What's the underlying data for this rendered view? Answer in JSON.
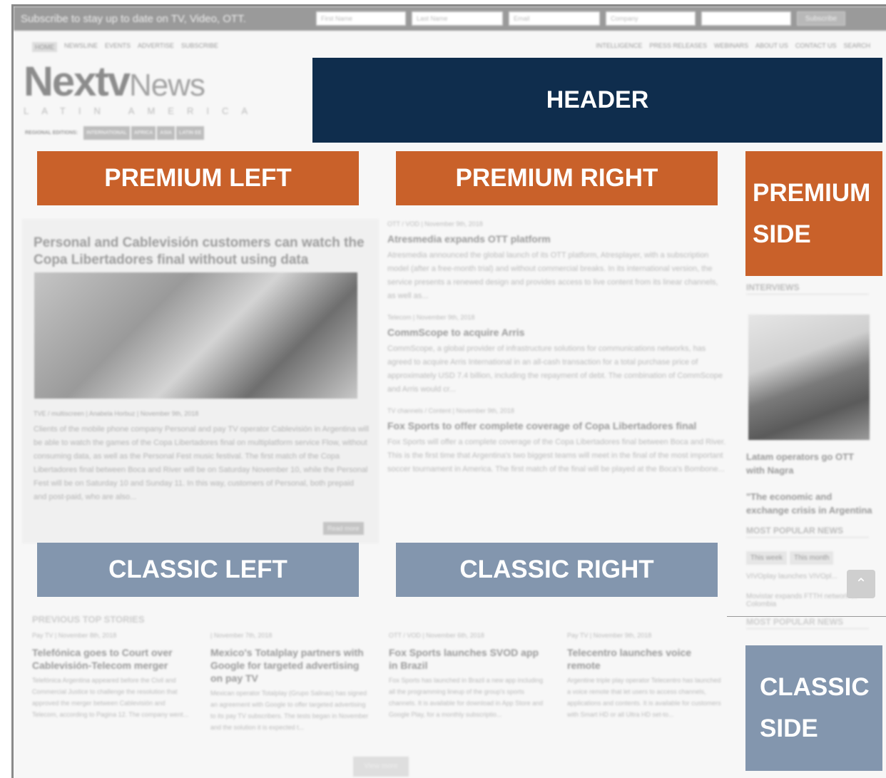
{
  "subscribe": {
    "text": "Subscribe to stay up to date on TV, Video, OTT.",
    "first_name_ph": "First Name",
    "last_name_ph": "Last Name",
    "email_ph": "Email",
    "company_ph": "Company",
    "button": "Subscribe"
  },
  "nav": {
    "left": [
      "Home",
      "Newsline",
      "Events",
      "Advertise",
      "Subscribe"
    ],
    "right": [
      "Intelligence",
      "Press Releases",
      "Webinars",
      "About Us",
      "Contact Us",
      "Search"
    ]
  },
  "logo": {
    "bold": "Nextv",
    "thin": "News",
    "sub": "LATIN AMERICA"
  },
  "editions": {
    "label": "REGIONAL EDITIONS:",
    "items": [
      "INTERNATIONAL",
      "AFRICA",
      "ASIA",
      "LATIN EE"
    ]
  },
  "overlays": {
    "header": "HEADER",
    "premium_left": "PREMIUM LEFT",
    "premium_right": "PREMIUM RIGHT",
    "premium_side_1": "PREMIUM",
    "premium_side_2": "SIDE",
    "classic_left": "CLASSIC LEFT",
    "classic_right": "CLASSIC RIGHT",
    "classic_side_1": "CLASSIC",
    "classic_side_2": "SIDE"
  },
  "feature": {
    "title": "Personal and Cablevisión customers can watch the Copa Libertadores final without using data",
    "meta": "TVE / multiscreen | Anabela Horbuz | November 9th, 2018",
    "body": "Clients of the mobile phone company Personal and pay TV operator Cablevisión in Argentina will be able to watch the games of the Copa Libertadores final on multiplatform service Flow, without consuming data, as well as the Personal Fest music festival. The first match of the Copa Libertadores final between Boca and River will be on Saturday November 10, while the Personal Fest will be on Saturday 10 and Sunday 11. In this way, customers of Personal, both prepaid and post-paid, who are also...",
    "read_more": "Read more"
  },
  "list": [
    {
      "meta": "OTT / VOD | November 9th, 2018",
      "title": "Atresmedia expands OTT platform",
      "body": "Atresmedia announced the global launch of its OTT platform, Atresplayer, with a subscription model (after a free-month trial) and without commercial breaks. In its international version, the service presents a renewed design and provides access to live content from its linear channels, as well as..."
    },
    {
      "meta": "Telecom | November 9th, 2018",
      "title": "CommScope to acquire Arris",
      "body": "CommScope, a global provider of infrastructure solutions for communications networks, has agreed to acquire Arris International in an all-cash transaction for a total purchase price of approximately USD 7.4 billion, including the repayment of debt. The combination of CommScope and Arris would cr..."
    },
    {
      "meta": "TV channels / Content | November 9th, 2018",
      "title": "Fox Sports to offer complete coverage of Copa Libertadores final",
      "body": "Fox Sports will offer a complete coverage of the Copa Libertadores final between Boca and River. This is the first time that Argentina's two biggest teams will meet in the final of the most important soccer tournament in America. The first match of the final will be played at the Boca's Bombone..."
    }
  ],
  "side": {
    "interviews": "INTERVIEWS",
    "interview_1": "Latam operators go OTT with Nagra",
    "interview_2": "\"The economic and exchange crisis in Argentina",
    "most_popular": "MOST POPULAR NEWS",
    "tab_week": "This week",
    "tab_month": "This month",
    "pop_1": "VIVOplay launches VIVOpl...",
    "pop_2": "Movistar expands FTTH network in Colombia",
    "most_popular_2": "MOST POPULAR NEWS",
    "scroll_up": "⌃"
  },
  "previous": {
    "heading": "PREVIOUS TOP STORIES",
    "stories": [
      {
        "meta": "Pay TV | November 8th, 2018",
        "title": "Telefónica goes to Court over Cablevisión-Telecom merger",
        "body": "Telefónica Argentina appeared before the Civil and Commercial Justice to challenge the resolution that approved the merger between Cablevisión and Telecom, according to Pagina 12. The company went..."
      },
      {
        "meta": "| November 7th, 2018",
        "title": "Mexico's Totalplay partners with Google for targeted advertising on pay TV",
        "body": "Mexican operator Totalplay (Grupo Salinas) has signed an agreement with Google to offer targeted advertising to its pay TV subscribers. The tests began in November and the solution it is expected t..."
      },
      {
        "meta": "OTT / VOD | November 6th, 2018",
        "title": "Fox Sports launches SVOD app in Brazil",
        "body": "Fox Sports has launched in Brazil a new app including all the programming lineup of the group's sports channels. It is available for download in App Store and Google Play, for a monthly subscriptio..."
      },
      {
        "meta": "Pay TV | November 9th, 2018",
        "title": "Telecentro launches voice remote",
        "body": "Argentine triple play operator Telecentro has launched a voice remote that let users to access channels, applications and contents. It is available for customers with Smart HD or all Ultra HD set-to..."
      }
    ],
    "view_more": "View more"
  }
}
